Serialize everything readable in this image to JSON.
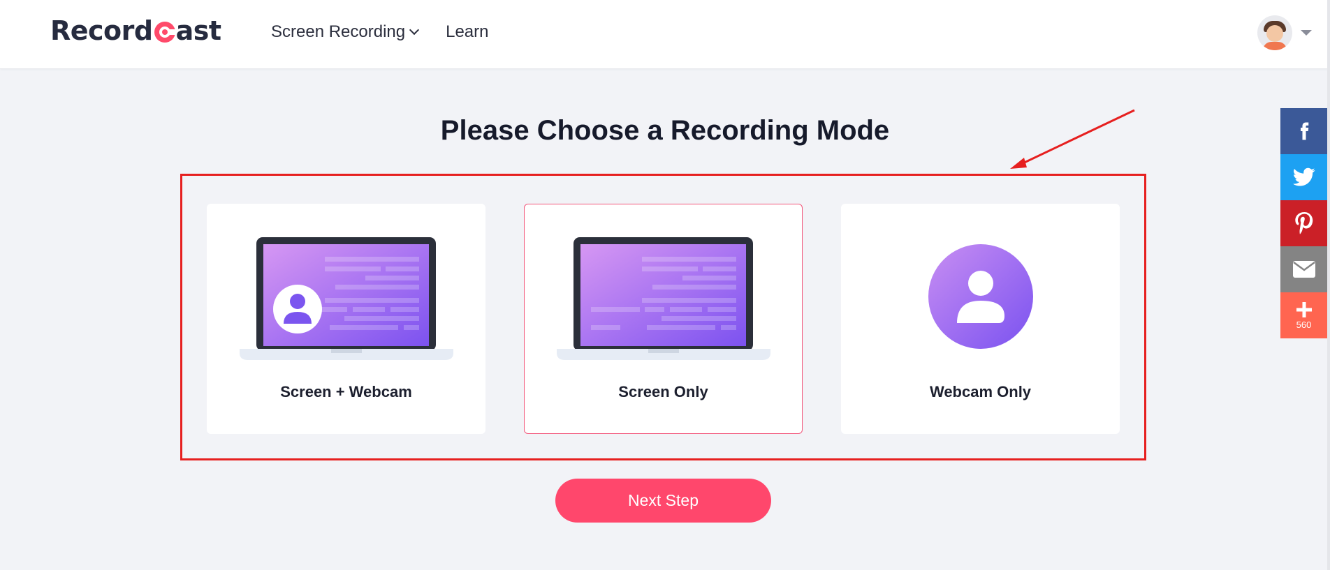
{
  "brand": {
    "name_prefix": "Record",
    "name_suffix": "ast",
    "accent_color": "#ff4a6a"
  },
  "nav": {
    "items": [
      {
        "label": "Screen Recording",
        "has_dropdown": true
      },
      {
        "label": "Learn",
        "has_dropdown": false
      }
    ]
  },
  "user": {
    "avatar_icon": "user-avatar-icon"
  },
  "page": {
    "title": "Please Choose a Recording Mode"
  },
  "modes": [
    {
      "label": "Screen + Webcam",
      "icon": "laptop-webcam-icon",
      "selected": false
    },
    {
      "label": "Screen Only",
      "icon": "laptop-screen-icon",
      "selected": true
    },
    {
      "label": "Webcam Only",
      "icon": "webcam-user-icon",
      "selected": false
    }
  ],
  "next_button": {
    "label": "Next Step",
    "color": "#ff476c"
  },
  "social": {
    "buttons": [
      {
        "name": "facebook",
        "color": "#3b5998"
      },
      {
        "name": "twitter",
        "color": "#1da1f2"
      },
      {
        "name": "pinterest",
        "color": "#cb2027"
      },
      {
        "name": "email",
        "color": "#848484"
      },
      {
        "name": "more",
        "color": "#ff6550",
        "count": "560"
      }
    ]
  },
  "annotation": {
    "color": "#e61f1f"
  }
}
